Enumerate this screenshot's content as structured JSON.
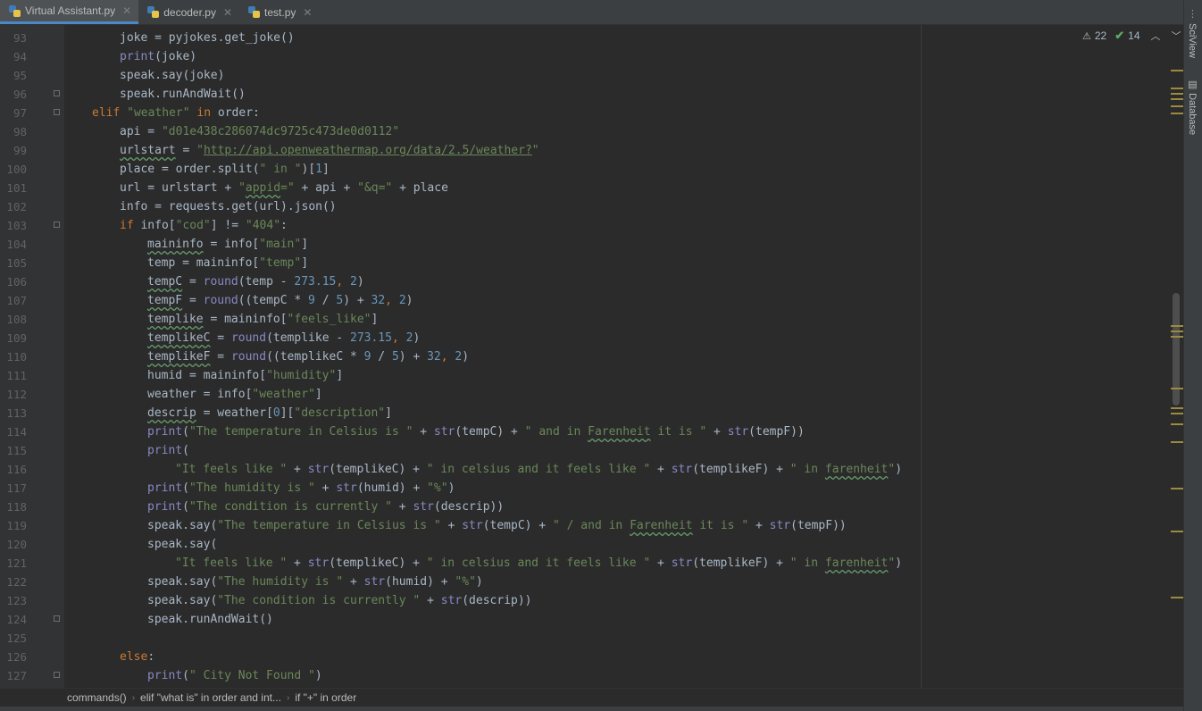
{
  "tabs": [
    {
      "label": "Virtual Assistant.py",
      "active": true
    },
    {
      "label": "decoder.py",
      "active": false
    },
    {
      "label": "test.py",
      "active": false
    }
  ],
  "right_tools": [
    "SciView",
    "Database"
  ],
  "inspection": {
    "warnings": "22",
    "passed": "14"
  },
  "breadcrumbs": [
    "commands()",
    "elif \"what is\" in order and int...",
    "if \"+\" in order"
  ],
  "code_lines": [
    {
      "n": "93",
      "fold": false,
      "indent": 2,
      "tokens": [
        [
          "",
          "joke = pyjokes.get_joke()"
        ]
      ]
    },
    {
      "n": "94",
      "fold": false,
      "indent": 2,
      "tokens": [
        [
          "bi",
          "print"
        ],
        [
          "",
          "(joke)"
        ]
      ]
    },
    {
      "n": "95",
      "fold": false,
      "indent": 2,
      "tokens": [
        [
          "",
          "speak.say(joke)"
        ]
      ]
    },
    {
      "n": "96",
      "fold": true,
      "indent": 2,
      "tokens": [
        [
          "",
          "speak.runAndWait()"
        ]
      ]
    },
    {
      "n": "97",
      "fold": true,
      "indent": 1,
      "tokens": [
        [
          "kw",
          "elif "
        ],
        [
          "str",
          "\"weather\""
        ],
        [
          "kw",
          " in "
        ],
        [
          "",
          "order:"
        ]
      ]
    },
    {
      "n": "98",
      "fold": false,
      "indent": 2,
      "tokens": [
        [
          "",
          "api = "
        ],
        [
          "str",
          "\"d01e438c286074dc9725c473de0d0112\""
        ]
      ]
    },
    {
      "n": "99",
      "fold": false,
      "indent": 2,
      "tokens": [
        [
          "wavy",
          "urlstart"
        ],
        [
          "",
          " = "
        ],
        [
          "str",
          "\""
        ],
        [
          "url",
          "http://api.openweathermap.org/data/2.5/weather?"
        ],
        [
          "str",
          "\""
        ]
      ]
    },
    {
      "n": "100",
      "fold": false,
      "indent": 2,
      "tokens": [
        [
          "",
          "place = order.split("
        ],
        [
          "str",
          "\" in \""
        ],
        [
          "",
          ")["
        ],
        [
          "num",
          "1"
        ],
        [
          "",
          "]"
        ]
      ]
    },
    {
      "n": "101",
      "fold": false,
      "indent": 2,
      "tokens": [
        [
          "",
          "url = urlstart + "
        ],
        [
          "str",
          "\""
        ],
        [
          "str wavy",
          "appid"
        ],
        [
          "str",
          "=\""
        ],
        [
          "",
          " + api + "
        ],
        [
          "str",
          "\"&q=\""
        ],
        [
          "",
          " + place"
        ]
      ]
    },
    {
      "n": "102",
      "fold": false,
      "indent": 2,
      "tokens": [
        [
          "",
          "info = requests.get(url).json()"
        ]
      ]
    },
    {
      "n": "103",
      "fold": true,
      "indent": 2,
      "tokens": [
        [
          "kw",
          "if "
        ],
        [
          "",
          "info["
        ],
        [
          "str",
          "\"cod\""
        ],
        [
          "",
          "] != "
        ],
        [
          "str",
          "\"404\""
        ],
        [
          "",
          ":"
        ]
      ]
    },
    {
      "n": "104",
      "fold": false,
      "indent": 3,
      "tokens": [
        [
          "wavy",
          "maininfo"
        ],
        [
          "",
          " = info["
        ],
        [
          "str",
          "\"main\""
        ],
        [
          "",
          "]"
        ]
      ]
    },
    {
      "n": "105",
      "fold": false,
      "indent": 3,
      "tokens": [
        [
          "",
          "temp = maininfo["
        ],
        [
          "str",
          "\"temp\""
        ],
        [
          "",
          "]"
        ]
      ]
    },
    {
      "n": "106",
      "fold": false,
      "indent": 3,
      "tokens": [
        [
          "wavy",
          "tempC"
        ],
        [
          "",
          " = "
        ],
        [
          "bi",
          "round"
        ],
        [
          "",
          "(temp - "
        ],
        [
          "num",
          "273.15"
        ],
        [
          "kw",
          ", "
        ],
        [
          "num",
          "2"
        ],
        [
          "",
          ")"
        ]
      ]
    },
    {
      "n": "107",
      "fold": false,
      "indent": 3,
      "tokens": [
        [
          "wavy",
          "tempF"
        ],
        [
          "",
          " = "
        ],
        [
          "bi",
          "round"
        ],
        [
          "",
          "((tempC * "
        ],
        [
          "num",
          "9"
        ],
        [
          "",
          " / "
        ],
        [
          "num",
          "5"
        ],
        [
          "",
          ") + "
        ],
        [
          "num",
          "32"
        ],
        [
          "kw",
          ", "
        ],
        [
          "num",
          "2"
        ],
        [
          "",
          ")"
        ]
      ]
    },
    {
      "n": "108",
      "fold": false,
      "indent": 3,
      "tokens": [
        [
          "wavy",
          "templike"
        ],
        [
          "",
          " = maininfo["
        ],
        [
          "str",
          "\"feels_like\""
        ],
        [
          "",
          "]"
        ]
      ]
    },
    {
      "n": "109",
      "fold": false,
      "indent": 3,
      "tokens": [
        [
          "wavy",
          "templikeC"
        ],
        [
          "",
          " = "
        ],
        [
          "bi",
          "round"
        ],
        [
          "",
          "(templike - "
        ],
        [
          "num",
          "273.15"
        ],
        [
          "kw",
          ", "
        ],
        [
          "num",
          "2"
        ],
        [
          "",
          ")"
        ]
      ]
    },
    {
      "n": "110",
      "fold": false,
      "indent": 3,
      "tokens": [
        [
          "wavy",
          "templikeF"
        ],
        [
          "",
          " = "
        ],
        [
          "bi",
          "round"
        ],
        [
          "",
          "((templikeC * "
        ],
        [
          "num",
          "9"
        ],
        [
          "",
          " / "
        ],
        [
          "num",
          "5"
        ],
        [
          "",
          ") + "
        ],
        [
          "num",
          "32"
        ],
        [
          "kw",
          ", "
        ],
        [
          "num",
          "2"
        ],
        [
          "",
          ")"
        ]
      ]
    },
    {
      "n": "111",
      "fold": false,
      "indent": 3,
      "tokens": [
        [
          "",
          "humid = maininfo["
        ],
        [
          "str",
          "\"humidity\""
        ],
        [
          "",
          "]"
        ]
      ]
    },
    {
      "n": "112",
      "fold": false,
      "indent": 3,
      "tokens": [
        [
          "",
          "weather = info["
        ],
        [
          "str",
          "\"weather\""
        ],
        [
          "",
          "]"
        ]
      ]
    },
    {
      "n": "113",
      "fold": false,
      "indent": 3,
      "tokens": [
        [
          "wavy",
          "descrip"
        ],
        [
          "",
          " = weather["
        ],
        [
          "num",
          "0"
        ],
        [
          "",
          "]["
        ],
        [
          "str",
          "\"description\""
        ],
        [
          "",
          "]"
        ]
      ]
    },
    {
      "n": "114",
      "fold": false,
      "indent": 3,
      "tokens": [
        [
          "bi",
          "print"
        ],
        [
          "",
          "("
        ],
        [
          "str",
          "\"The temperature in Celsius is \""
        ],
        [
          "",
          " + "
        ],
        [
          "bi",
          "str"
        ],
        [
          "",
          "(tempC) + "
        ],
        [
          "str",
          "\" and in "
        ],
        [
          "str wavy",
          "Farenheit"
        ],
        [
          "str",
          " it is \""
        ],
        [
          "",
          " + "
        ],
        [
          "bi",
          "str"
        ],
        [
          "",
          "(tempF))"
        ]
      ]
    },
    {
      "n": "115",
      "fold": false,
      "indent": 3,
      "tokens": [
        [
          "bi",
          "print"
        ],
        [
          "",
          "("
        ]
      ]
    },
    {
      "n": "116",
      "fold": false,
      "indent": 4,
      "tokens": [
        [
          "str",
          "\"It feels like \""
        ],
        [
          "",
          " + "
        ],
        [
          "bi",
          "str"
        ],
        [
          "",
          "(templikeC) + "
        ],
        [
          "str",
          "\" in celsius and it feels like \""
        ],
        [
          "",
          " + "
        ],
        [
          "bi",
          "str"
        ],
        [
          "",
          "(templikeF) + "
        ],
        [
          "str",
          "\" in "
        ],
        [
          "str wavy",
          "farenheit"
        ],
        [
          "str",
          "\""
        ],
        [
          "",
          ")"
        ]
      ]
    },
    {
      "n": "117",
      "fold": false,
      "indent": 3,
      "tokens": [
        [
          "bi",
          "print"
        ],
        [
          "",
          "("
        ],
        [
          "str",
          "\"The humidity is \""
        ],
        [
          "",
          " + "
        ],
        [
          "bi",
          "str"
        ],
        [
          "",
          "(humid) + "
        ],
        [
          "str",
          "\"%\""
        ],
        [
          "",
          ")"
        ]
      ]
    },
    {
      "n": "118",
      "fold": false,
      "indent": 3,
      "tokens": [
        [
          "bi",
          "print"
        ],
        [
          "",
          "("
        ],
        [
          "str",
          "\"The condition is currently \""
        ],
        [
          "",
          " + "
        ],
        [
          "bi",
          "str"
        ],
        [
          "",
          "(descrip))"
        ]
      ]
    },
    {
      "n": "119",
      "fold": false,
      "indent": 3,
      "tokens": [
        [
          "",
          "speak.say("
        ],
        [
          "str",
          "\"The temperature in Celsius is \""
        ],
        [
          "",
          " + "
        ],
        [
          "bi",
          "str"
        ],
        [
          "",
          "(tempC) + "
        ],
        [
          "str",
          "\" / and in "
        ],
        [
          "str wavy",
          "Farenheit"
        ],
        [
          "str",
          " it is \""
        ],
        [
          "",
          " + "
        ],
        [
          "bi",
          "str"
        ],
        [
          "",
          "(tempF))"
        ]
      ]
    },
    {
      "n": "120",
      "fold": false,
      "indent": 3,
      "tokens": [
        [
          "",
          "speak.say("
        ]
      ]
    },
    {
      "n": "121",
      "fold": false,
      "indent": 4,
      "tokens": [
        [
          "str",
          "\"It feels like \""
        ],
        [
          "",
          " + "
        ],
        [
          "bi",
          "str"
        ],
        [
          "",
          "(templikeC) + "
        ],
        [
          "str",
          "\" in celsius and it feels like \""
        ],
        [
          "",
          " + "
        ],
        [
          "bi",
          "str"
        ],
        [
          "",
          "(templikeF) + "
        ],
        [
          "str",
          "\" in "
        ],
        [
          "str wavy",
          "farenheit"
        ],
        [
          "str",
          "\""
        ],
        [
          "",
          ")"
        ]
      ]
    },
    {
      "n": "122",
      "fold": false,
      "indent": 3,
      "tokens": [
        [
          "",
          "speak.say("
        ],
        [
          "str",
          "\"The humidity is \""
        ],
        [
          "",
          " + "
        ],
        [
          "bi",
          "str"
        ],
        [
          "",
          "(humid) + "
        ],
        [
          "str",
          "\"%\""
        ],
        [
          "",
          ")"
        ]
      ]
    },
    {
      "n": "123",
      "fold": false,
      "indent": 3,
      "tokens": [
        [
          "",
          "speak.say("
        ],
        [
          "str",
          "\"The condition is currently \""
        ],
        [
          "",
          " + "
        ],
        [
          "bi",
          "str"
        ],
        [
          "",
          "(descrip))"
        ]
      ]
    },
    {
      "n": "124",
      "fold": true,
      "indent": 3,
      "tokens": [
        [
          "",
          "speak.runAndWait()"
        ]
      ]
    },
    {
      "n": "125",
      "fold": false,
      "indent": 0,
      "tokens": []
    },
    {
      "n": "126",
      "fold": false,
      "indent": 2,
      "tokens": [
        [
          "kw",
          "else"
        ],
        [
          "",
          ":"
        ]
      ]
    },
    {
      "n": "127",
      "fold": true,
      "indent": 3,
      "tokens": [
        [
          "bi",
          "print"
        ],
        [
          "",
          "("
        ],
        [
          "str",
          "\" City Not Found \""
        ],
        [
          "",
          ")"
        ]
      ]
    }
  ]
}
